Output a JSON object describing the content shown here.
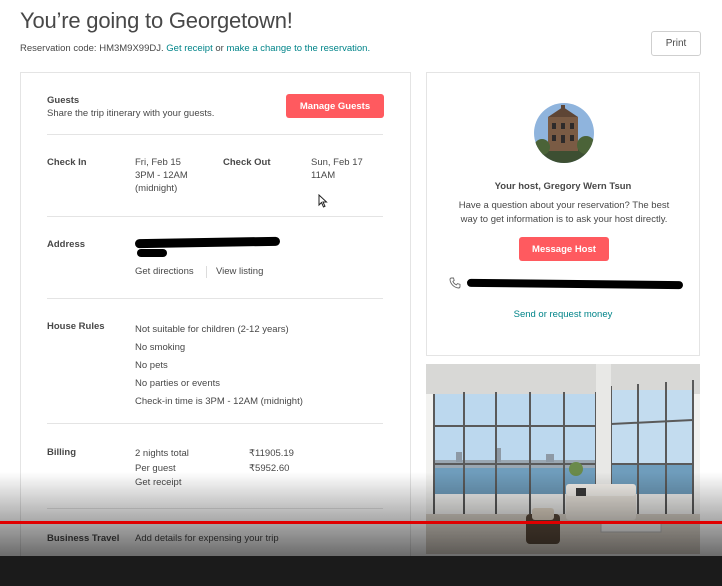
{
  "page": {
    "title": "You’re going to Georgetown!",
    "reservation_prefix": "Reservation code: HM3M9X99DJ.",
    "get_receipt": "Get receipt",
    "or_text": "or",
    "change_link": "make a change to the reservation.",
    "print_label": "Print"
  },
  "guests": {
    "heading": "Guests",
    "subtitle": "Share the trip itinerary with your guests.",
    "button": "Manage Guests"
  },
  "checkin": {
    "label": "Check In",
    "date": "Fri, Feb 15",
    "time": "3PM - 12AM",
    "note": "(midnight)"
  },
  "checkout": {
    "label": "Check Out",
    "date": "Sun, Feb 17",
    "time": "11AM"
  },
  "address": {
    "label": "Address",
    "directions": "Get directions",
    "listing": "View listing"
  },
  "house_rules": {
    "label": "House Rules",
    "items": [
      "Not suitable for children (2-12 years)",
      "No smoking",
      "No pets",
      "No parties or events",
      "Check-in time is 3PM - 12AM (midnight)"
    ]
  },
  "billing": {
    "label": "Billing",
    "nights_label": "2 nights total",
    "nights_value": "₹11905.19",
    "per_guest_label": "Per guest",
    "per_guest_value": "₹5952.60",
    "receipt": "Get receipt"
  },
  "business": {
    "label": "Business Travel",
    "link": "Add details for expensing your trip"
  },
  "host": {
    "name": "Your host, Gregory Wern Tsun",
    "text": "Have a question about your reservation? The best way to get information is to ask your host directly.",
    "button": "Message Host",
    "money_link": "Send or request money"
  },
  "colors": {
    "accent": "#ff5a5f",
    "link": "#008489",
    "progress": "#e00000"
  }
}
